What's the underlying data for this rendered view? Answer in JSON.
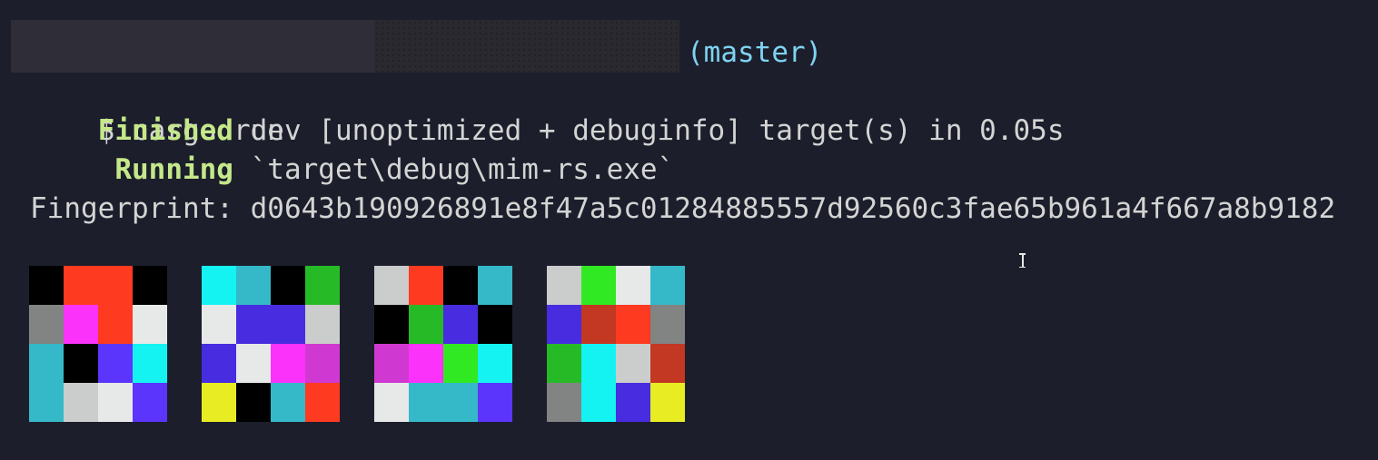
{
  "prompt": {
    "branch": "(master)",
    "symbol": "$",
    "command": "cargo run"
  },
  "output": {
    "finished_label": "Finished",
    "finished_text": " dev [unoptimized + debuginfo] target(s) in 0.05s",
    "running_label": "Running",
    "running_text": " `target\\debug\\mim-rs.exe`",
    "fingerprint_label": "Fingerprint:",
    "fingerprint_value": "d0643b190926891e8f47a5c01284885557d92560c3fae65b961a4f667a8b9182"
  },
  "colors": {
    "background": "#1c1f2b",
    "text": "#d4d4d4",
    "status_green": "#c5e88a",
    "branch_cyan": "#7fd3f2"
  },
  "palette": {
    "black": "#000000",
    "red": "#fe3a20",
    "darkred": "#c23822",
    "gray": "#828383",
    "magenta": "#fb32fa",
    "purple": "#d039d1",
    "white": "#e7e8e8",
    "silver": "#cbcccc",
    "teal": "#35b9c8",
    "cyan": "#15f2f2",
    "violet": "#5c35fd",
    "indigo": "#482ce0",
    "green": "#27ba27",
    "lime": "#31e923",
    "yellow": "#e8ec22"
  },
  "identicons": [
    {
      "cells": [
        "black",
        "red",
        "red",
        "black",
        "gray",
        "magenta",
        "red",
        "white",
        "teal",
        "black",
        "violet",
        "cyan",
        "teal",
        "silver",
        "white",
        "violet"
      ]
    },
    {
      "cells": [
        "cyan",
        "teal",
        "black",
        "green",
        "white",
        "indigo",
        "indigo",
        "silver",
        "indigo",
        "white",
        "magenta",
        "purple",
        "yellow",
        "black",
        "teal",
        "red"
      ]
    },
    {
      "cells": [
        "silver",
        "red",
        "black",
        "teal",
        "black",
        "green",
        "indigo",
        "black",
        "purple",
        "magenta",
        "lime",
        "cyan",
        "white",
        "teal",
        "teal",
        "violet"
      ]
    },
    {
      "cells": [
        "silver",
        "lime",
        "white",
        "teal",
        "indigo",
        "darkred",
        "red",
        "gray",
        "green",
        "cyan",
        "silver",
        "darkred",
        "gray",
        "cyan",
        "indigo",
        "yellow"
      ]
    }
  ],
  "cursor": {
    "icon": "text-cursor-ibeam-icon"
  }
}
